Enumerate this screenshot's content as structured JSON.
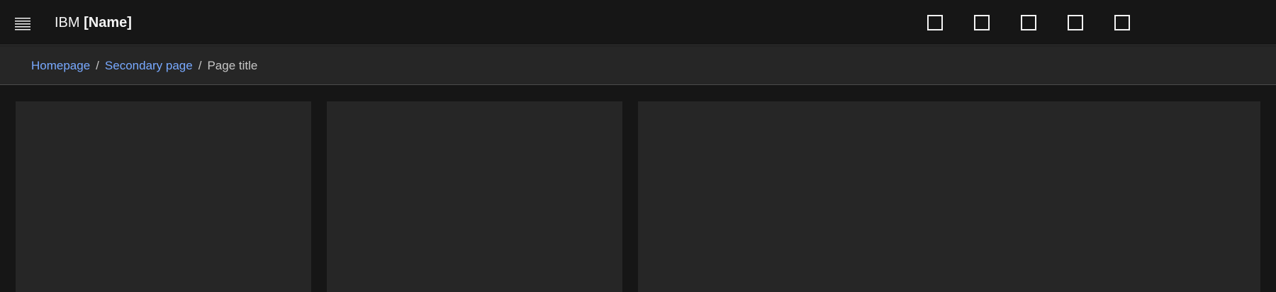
{
  "header": {
    "brand_prefix": "IBM",
    "brand_name": "[Name]",
    "menu_icon": "hamburger-menu-icon",
    "action_icons": [
      "square-icon",
      "square-icon",
      "square-icon",
      "square-icon",
      "square-icon"
    ]
  },
  "breadcrumb": {
    "items": [
      {
        "label": "Homepage",
        "link": true
      },
      {
        "label": "Secondary page",
        "link": true
      },
      {
        "label": "Page title",
        "link": false
      }
    ],
    "separator": "/"
  },
  "colors": {
    "background": "#161616",
    "header_bg": "#161616",
    "breadcrumb_bg": "#262626",
    "tile_bg": "#262626",
    "link": "#78a9ff",
    "text": "#f4f4f4",
    "muted_text": "#c6c6c6"
  }
}
